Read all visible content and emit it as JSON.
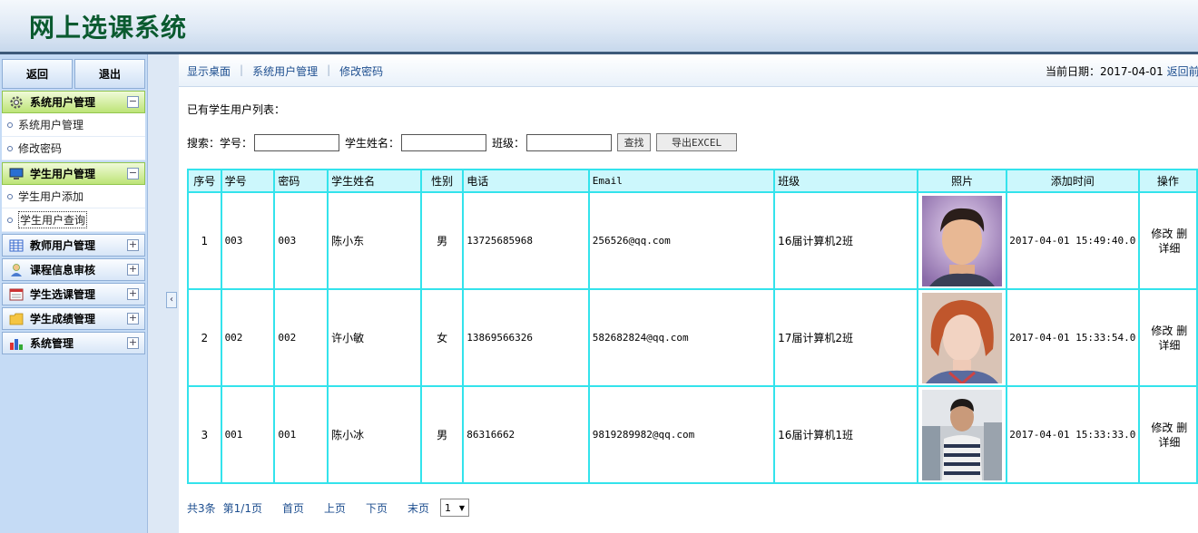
{
  "app": {
    "title": "网上选课系统"
  },
  "sidebar": {
    "top_buttons": [
      "返回",
      "退出"
    ],
    "sections": [
      {
        "label": "系统用户管理",
        "icon": "gear-icon",
        "open": true,
        "items": [
          "系统用户管理",
          "修改密码"
        ]
      },
      {
        "label": "学生用户管理",
        "icon": "monitor-icon",
        "open": true,
        "items": [
          "学生用户添加",
          "学生用户查询"
        ]
      },
      {
        "label": "教师用户管理",
        "icon": "grid-icon",
        "open": false,
        "items": []
      },
      {
        "label": "课程信息审核",
        "icon": "person-icon",
        "open": false,
        "items": []
      },
      {
        "label": "学生选课管理",
        "icon": "calendar-icon",
        "open": false,
        "items": []
      },
      {
        "label": "学生成绩管理",
        "icon": "folder-icon",
        "open": false,
        "items": []
      },
      {
        "label": "系统管理",
        "icon": "bar-chart-icon",
        "open": false,
        "items": []
      }
    ],
    "toggle_open": "−",
    "toggle_closed": "+"
  },
  "nav": {
    "links": [
      "显示桌面",
      "系统用户管理",
      "修改密码"
    ],
    "date_label": "当前日期：2017-04-01",
    "back_label": "返回前一"
  },
  "content": {
    "list_title": "已有学生用户列表：",
    "search": {
      "prefix": "搜索：",
      "fields": [
        "学号：",
        "学生姓名：",
        "班级："
      ],
      "find_button": "查找",
      "export_button": "导出EXCEL"
    },
    "table": {
      "headers": [
        "序号",
        "学号",
        "密码",
        "学生姓名",
        "性别",
        "电话",
        "Email",
        "班级",
        "照片",
        "添加时间",
        "操作"
      ],
      "rows": [
        {
          "no": "1",
          "id": "003",
          "pwd": "003",
          "name": "陈小东",
          "sex": "男",
          "phone": "13725685968",
          "email": "256526@qq.com",
          "class": "16届计算机2班",
          "time": "2017-04-01 15:49:40.0",
          "ops": [
            "修改",
            "删",
            "详细"
          ]
        },
        {
          "no": "2",
          "id": "002",
          "pwd": "002",
          "name": "许小敏",
          "sex": "女",
          "phone": "13869566326",
          "email": "582682824@qq.com",
          "class": "17届计算机2班",
          "time": "2017-04-01 15:33:54.0",
          "ops": [
            "修改",
            "删",
            "详细"
          ]
        },
        {
          "no": "3",
          "id": "001",
          "pwd": "001",
          "name": "陈小冰",
          "sex": "男",
          "phone": "86316662",
          "email": "9819289982@qq.com",
          "class": "16届计算机1班",
          "time": "2017-04-01 15:33:33.0",
          "ops": [
            "修改",
            "删",
            "详细"
          ]
        }
      ]
    },
    "pager": {
      "total": "共3条",
      "page": "第1/1页",
      "first": "首页",
      "prev": "上页",
      "next": "下页",
      "last": "末页",
      "selected": "1"
    }
  },
  "colors": {
    "header_title": "#0a5a2f",
    "table_border": "#33e3ec",
    "table_header_bg": "#ccf7fc",
    "link": "#1d4e8f"
  }
}
